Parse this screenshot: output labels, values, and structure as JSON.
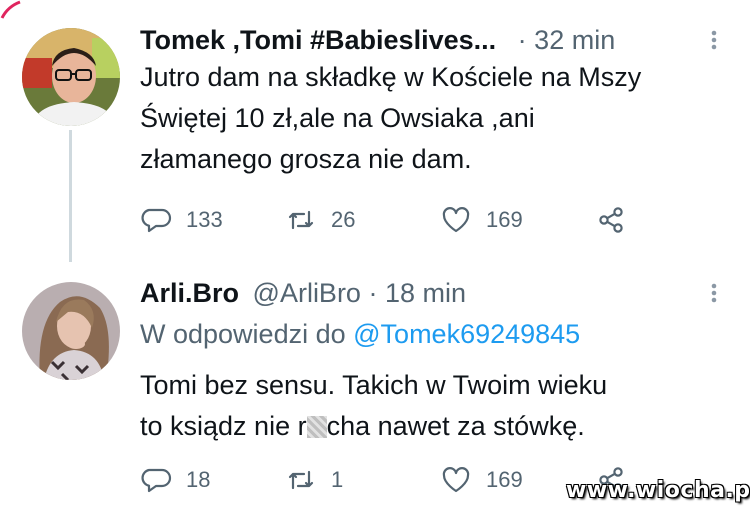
{
  "tweets": [
    {
      "display_name": "Tomek ,Tomi #Babieslives...",
      "dot": "·",
      "time": "32 min",
      "text": "Jutro dam na składkę w Kościele na Mszy\nŚwiętej 10 zł,ale na Owsiaka ,ani\nzłamanego grosza nie dam.",
      "replies": "133",
      "retweets": "26",
      "likes": "169"
    },
    {
      "display_name": "Arli.Bro",
      "handle": "@ArliBro",
      "dot": "·",
      "time": "18 min",
      "reply_prefix": "W odpowiedzi do",
      "reply_mention": "@Tomek69249845",
      "text_line1": "Tomi bez sensu. Takich w Twoim wieku",
      "text_line2_a": "to ksiądz nie r",
      "text_line2_b": "cha nawet za stówkę.",
      "replies": "18",
      "retweets": "1",
      "likes": "169"
    }
  ],
  "watermark": "www.wiocha.pl",
  "colors": {
    "text": "#0f1419",
    "secondary": "#536471",
    "link": "#1d9bf0",
    "thread_line": "#cfd9de"
  }
}
